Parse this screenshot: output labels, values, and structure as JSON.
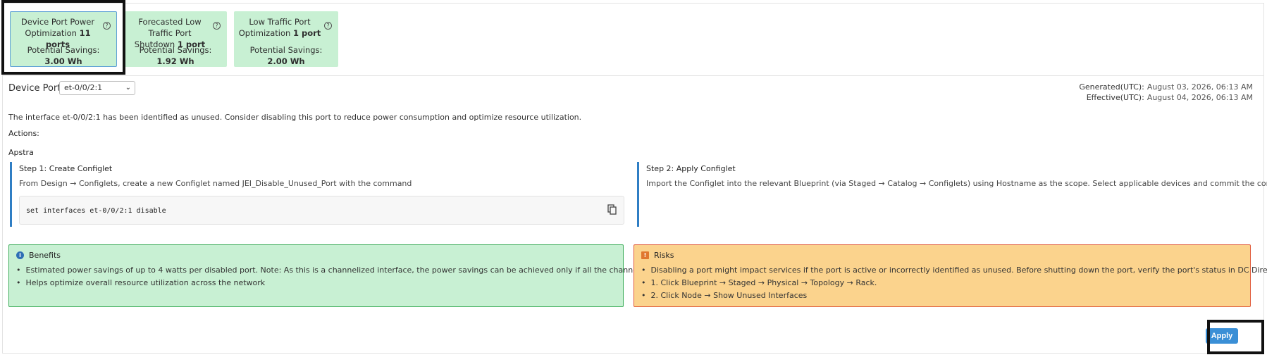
{
  "cards": [
    {
      "title_prefix": "Device Port Power Optimization",
      "title_count": "11 ports",
      "savings_label": "Potential Savings:",
      "savings_value": "3.00 Wh",
      "help": "?"
    },
    {
      "title_prefix": "Forecasted Low Traffic Port Shutdown",
      "title_count": "1 port",
      "savings_label": "Potential Savings:",
      "savings_value": "1.92 Wh",
      "help": "?"
    },
    {
      "title_prefix": "Low Traffic Port Optimization",
      "title_count": "1 port",
      "savings_label": "Potential Savings:",
      "savings_value": "2.00 Wh",
      "help": "?"
    }
  ],
  "device_port": {
    "label": "Device Port",
    "selected": "et-0/0/2:1"
  },
  "meta": {
    "generated_label": "Generated(UTC):",
    "generated_value": "August 03, 2026, 06:13 AM",
    "effective_label": "Effective(UTC):",
    "effective_value": "August 04, 2026, 06:13 AM"
  },
  "description": "The interface et-0/0/2:1 has been identified as unused. Consider disabling this port to reduce power consumption and optimize resource utilization.",
  "actions_label": "Actions:",
  "apstra_label": "Apstra",
  "step1": {
    "title": "Step 1: Create Configlet",
    "desc": "From Design → Configlets, create a new Configlet named JEI_Disable_Unused_Port with the command",
    "code": "set interfaces et-0/0/2:1 disable"
  },
  "step2": {
    "title": "Step 2: Apply Configlet",
    "desc": "Import the Configlet into the relevant Blueprint (via Staged → Catalog → Configlets) using Hostname as the scope. Select applicable devices and commit the configuration"
  },
  "benefits": {
    "title": "Benefits",
    "icon": "i",
    "items": [
      "Estimated power savings of up to 4 watts per disabled port. Note: As this is a channelized interface, the power savings can be achieved only if all the channels are disabled.",
      "Helps optimize overall resource utilization across the network"
    ]
  },
  "risks": {
    "title": "Risks",
    "icon": "!",
    "items": [
      "Disabling a port might impact services if the port is active or incorrectly identified as unused. Before shutting down the port, verify the port's status in DC Director:",
      "1. Click Blueprint → Staged → Physical → Topology → Rack.",
      "2. Click Node → Show Unused Interfaces"
    ]
  },
  "apply_label": "Apply",
  "colors": {
    "accent": "#3a8fd6",
    "benefits_bg": "#c8f0d3",
    "risks_bg": "#fbd38d",
    "step_bar": "#2f7ec4"
  }
}
